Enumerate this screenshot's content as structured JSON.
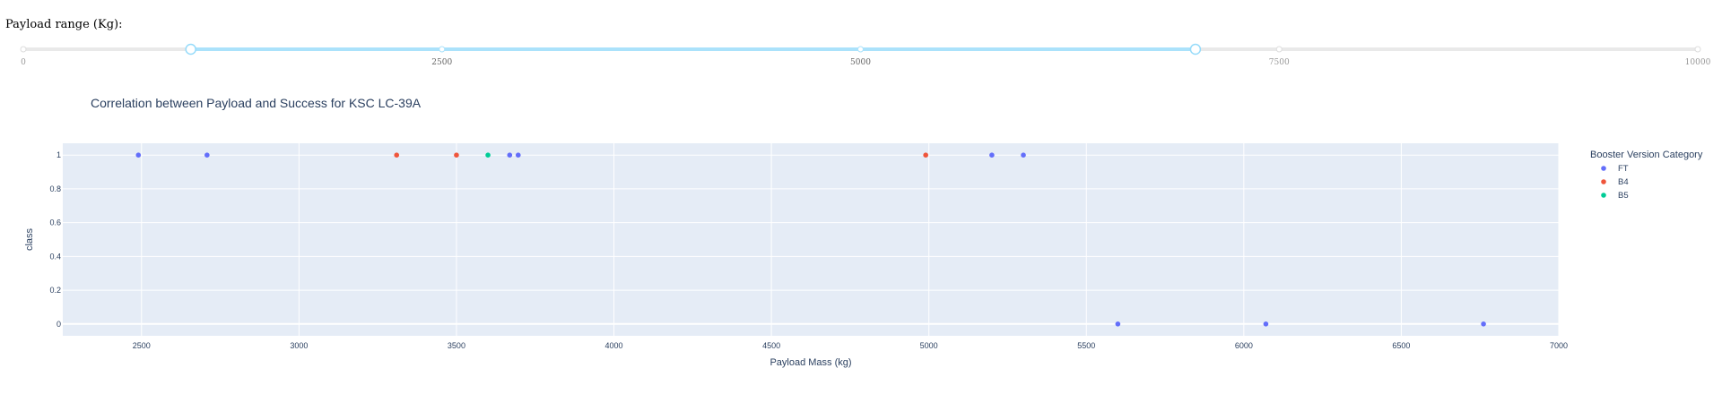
{
  "slider": {
    "label": "Payload range (Kg):",
    "min": 0,
    "max": 10000,
    "range": [
      1000,
      7000
    ],
    "marks": [
      {
        "value": 0,
        "label": "0"
      },
      {
        "value": 2500,
        "label": "2500"
      },
      {
        "value": 5000,
        "label": "5000"
      },
      {
        "value": 7500,
        "label": "7500"
      },
      {
        "value": 10000,
        "label": "10000"
      }
    ],
    "colors": {
      "track": "#e9e9e9",
      "selected": "#abe2fb",
      "handle": "#96dbfa"
    }
  },
  "chart_data": {
    "type": "scatter",
    "title": "Correlation between Payload and Success for KSC LC-39A",
    "xlabel": "Payload Mass (kg)",
    "ylabel": "class",
    "xlim": [
      2250,
      7000
    ],
    "ylim": [
      -0.07,
      1.07
    ],
    "xticks": [
      2500,
      3000,
      3500,
      4000,
      4500,
      5000,
      5500,
      6000,
      6500,
      7000
    ],
    "yticks": [
      0,
      0.2,
      0.4,
      0.6,
      0.8,
      1
    ],
    "legend_title": "Booster Version Category",
    "legend_position": "right",
    "grid": true,
    "colors": {
      "plot_bg": "#e5ecf6",
      "grid": "#ffffff",
      "text": "#2a3f5f"
    },
    "series": [
      {
        "name": "FT",
        "color": "#636efa",
        "points": [
          [
            2490,
            1
          ],
          [
            2708,
            1
          ],
          [
            3669,
            1
          ],
          [
            3696,
            1
          ],
          [
            5200,
            1
          ],
          [
            5300,
            1
          ],
          [
            5600,
            0
          ],
          [
            6070,
            0
          ],
          [
            6761,
            0
          ]
        ]
      },
      {
        "name": "B4",
        "color": "#ef553b",
        "points": [
          [
            3310,
            1
          ],
          [
            3500,
            1
          ],
          [
            4990,
            1
          ]
        ]
      },
      {
        "name": "B5",
        "color": "#00cc96",
        "points": [
          [
            3600,
            1
          ]
        ]
      }
    ]
  }
}
